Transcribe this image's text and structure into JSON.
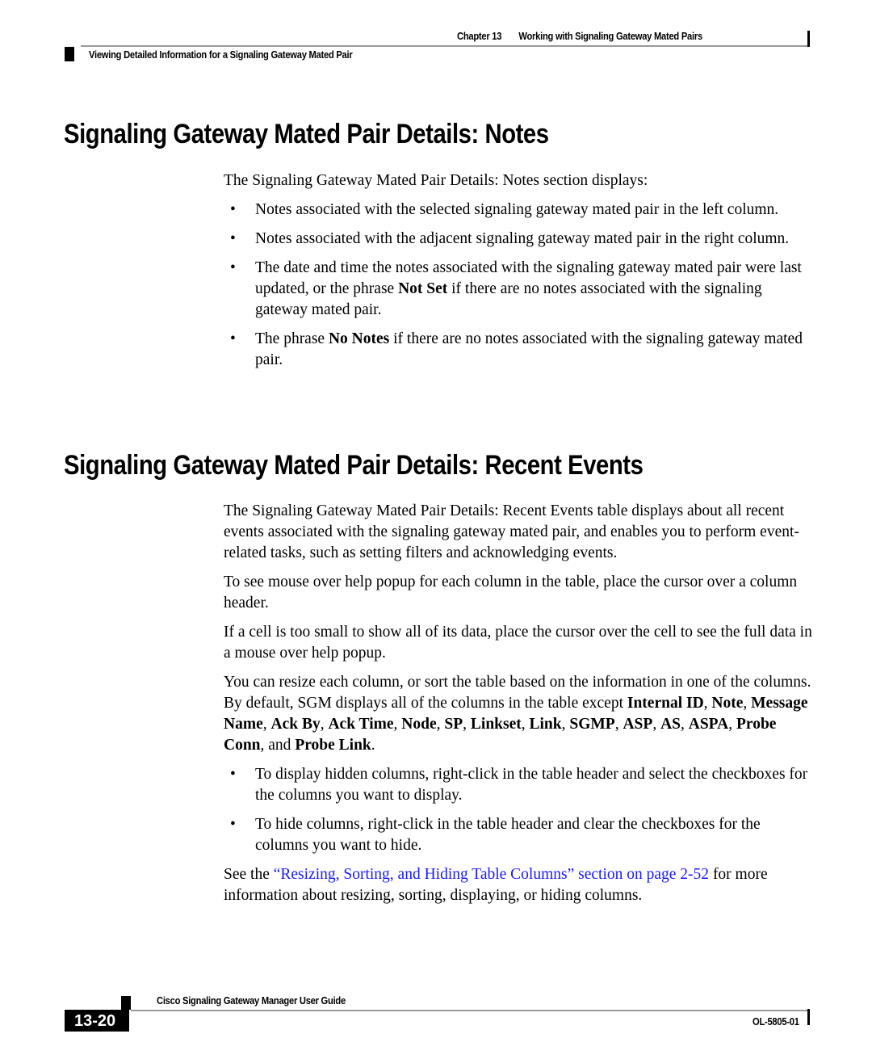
{
  "header": {
    "chapter_label": "Chapter 13",
    "chapter_title": "Working with Signaling Gateway Mated Pairs",
    "section_title": "Viewing Detailed Information for a Signaling Gateway Mated Pair"
  },
  "notes_section": {
    "heading": "Signaling Gateway Mated Pair Details: Notes",
    "intro": "The Signaling Gateway Mated Pair Details: Notes section displays:",
    "bullets": {
      "b0": "Notes associated with the selected signaling gateway mated pair in the left column.",
      "b1": "Notes associated with the adjacent signaling gateway mated pair in the right column.",
      "b2_pre": "The date and time the notes associated with the signaling gateway mated pair were last updated, or the phrase ",
      "b2_bold": "Not Set",
      "b2_post": " if there are no notes associated with the signaling gateway mated pair.",
      "b3_pre": "The phrase ",
      "b3_bold": "No Notes",
      "b3_post": " if there are no notes associated with the signaling gateway mated pair."
    }
  },
  "events_section": {
    "heading": "Signaling Gateway Mated Pair Details: Recent Events",
    "p1": "The Signaling Gateway Mated Pair Details: Recent Events table displays about all recent events associated with the signaling gateway mated pair, and enables you to perform event-related tasks, such as setting filters and acknowledging events.",
    "p2": "To see mouse over help popup for each column in the table, place the cursor over a column header.",
    "p3": "If a cell is too small to show all of its data, place the cursor over the cell to see the full data in a mouse over help popup.",
    "p4_pre": "You can resize each column, or sort the table based on the information in one of the columns. By default, SGM displays all of the columns in the table except ",
    "hidden_columns": [
      "Internal ID",
      "Note",
      "Message Name",
      "Ack By",
      "Ack Time",
      "Node",
      "SP",
      "Linkset",
      "Link",
      "SGMP",
      "ASP",
      "AS",
      "ASPA",
      "Probe Conn",
      "Probe Link"
    ],
    "sep": ", ",
    "and_word": ", and ",
    "period": ".",
    "bullet_display": "To display hidden columns, right-click in the table header and select the checkboxes for the columns you want to display.",
    "bullet_hide": "To hide columns, right-click in the table header and clear the checkboxes for the columns you want to hide.",
    "see_pre": "See the ",
    "see_link": "“Resizing, Sorting, and Hiding Table Columns” section on page 2-52",
    "see_post": " for more information about resizing, sorting, displaying, or hiding columns."
  },
  "footer": {
    "guide_title": "Cisco Signaling Gateway Manager User Guide",
    "page_number": "13-20",
    "doc_number": "OL-5805-01"
  },
  "bullet_glyph": "•",
  "colors": {
    "link": "#1a1aff",
    "rule": "#999999"
  }
}
